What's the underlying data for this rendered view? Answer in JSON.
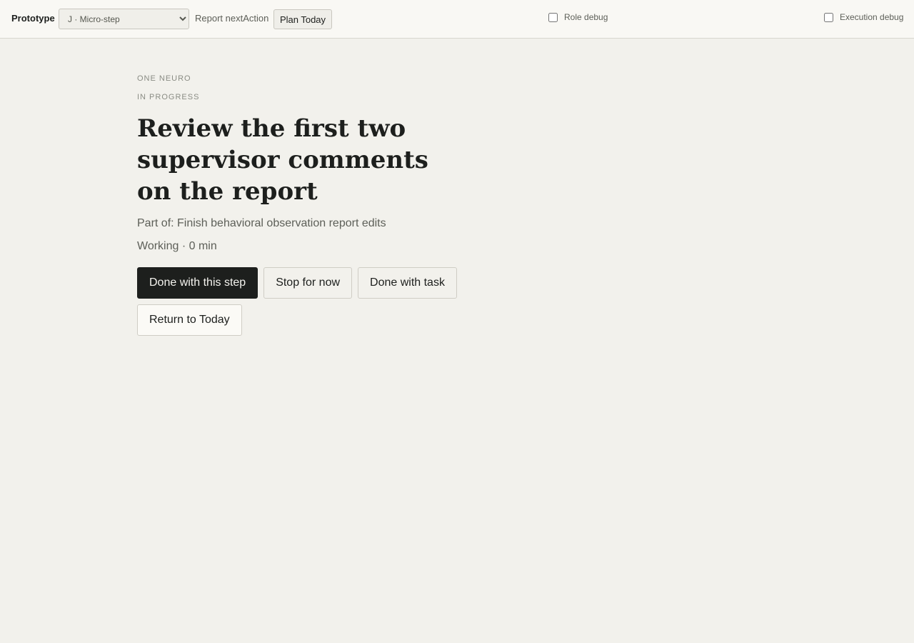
{
  "toolbar": {
    "prototype_label": "Prototype",
    "prototype_select": {
      "selected": "J · Micro-step"
    },
    "report_label": "Report nextAction",
    "plan_today_label": "Plan Today",
    "role_debug_label": "Role debug",
    "role_debug_checked": false,
    "execution_debug_label": "Execution debug",
    "execution_debug_checked": false
  },
  "main": {
    "area": "ONE NEURO",
    "state": "IN PROGRESS",
    "step_title": "Review the first two supervisor comments on the report",
    "parent_task": "Part of: Finish behavioral observation report edits",
    "status": "Working · 0 min",
    "actions": {
      "done_step": "Done with this step",
      "stop": "Stop for now",
      "done_task": "Done with task",
      "return_today": "Return to Today"
    }
  },
  "colors": {
    "background": "#f2f1ec",
    "toolbar_background": "#f9f8f4",
    "primary_button": "#1d1f1d",
    "muted_text": "#5d5f58"
  }
}
